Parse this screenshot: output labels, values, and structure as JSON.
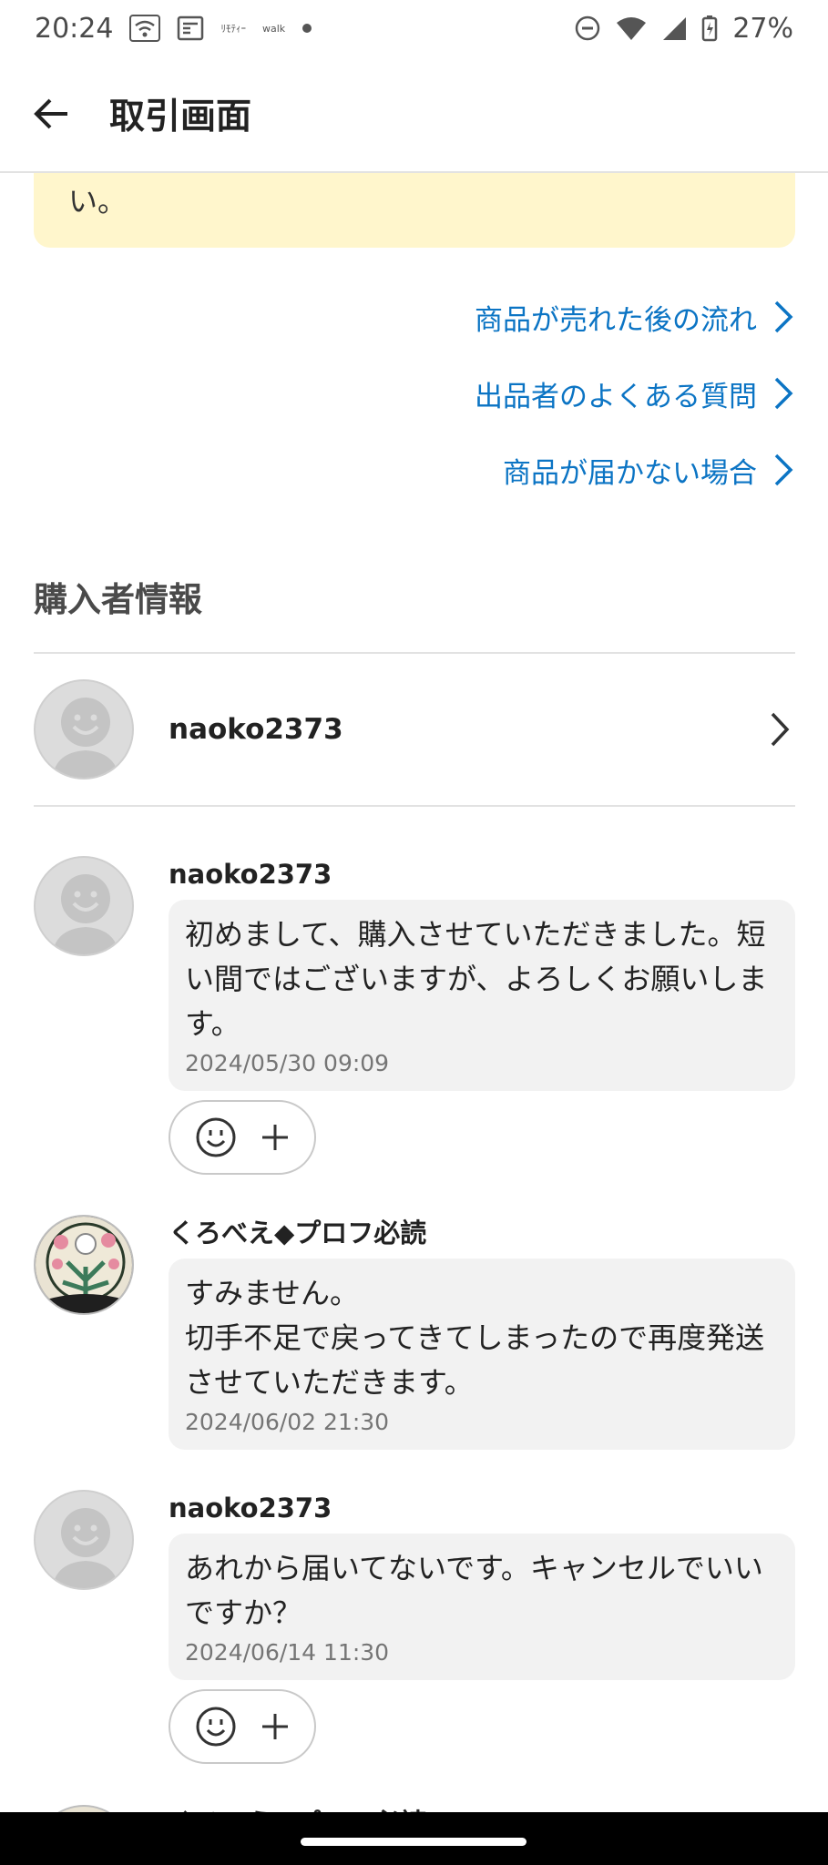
{
  "status_bar": {
    "time": "20:24",
    "mini_icon_1": "ﾘﾓﾃｨｰ",
    "mini_icon_2": "walk",
    "battery": "27%"
  },
  "header": {
    "title": "取引画面",
    "back_icon": "arrow-left-icon"
  },
  "notice": {
    "text": "い。"
  },
  "help_links": [
    {
      "label": "商品が売れた後の流れ"
    },
    {
      "label": "出品者のよくある質問"
    },
    {
      "label": "商品が届かない場合"
    }
  ],
  "buyer_section": {
    "title": "購入者情報",
    "name": "naoko2373"
  },
  "messages": [
    {
      "sender": "naoko2373",
      "text": "初めまして、購入させていただきました。短い間ではございますが、よろしくお願いします。",
      "time": "2024/05/30 09:09"
    },
    {
      "sender": "くろべえ◆プロフ必読",
      "text": "すみません。\n切手不足で戻ってきてしまったので再度発送させていただきます。",
      "time": "2024/06/02 21:30"
    },
    {
      "sender": "naoko2373",
      "text": "あれから届いてないです。キャンセルでいいですか？",
      "time": "2024/06/14 11:30"
    },
    {
      "sender": "くろべえ◆プロフ必読"
    }
  ],
  "colors": {
    "link": "#0b74c4",
    "notice_bg": "#fff6cc",
    "bubble_bg": "#f2f2f2",
    "divider": "#e2e2e2"
  }
}
